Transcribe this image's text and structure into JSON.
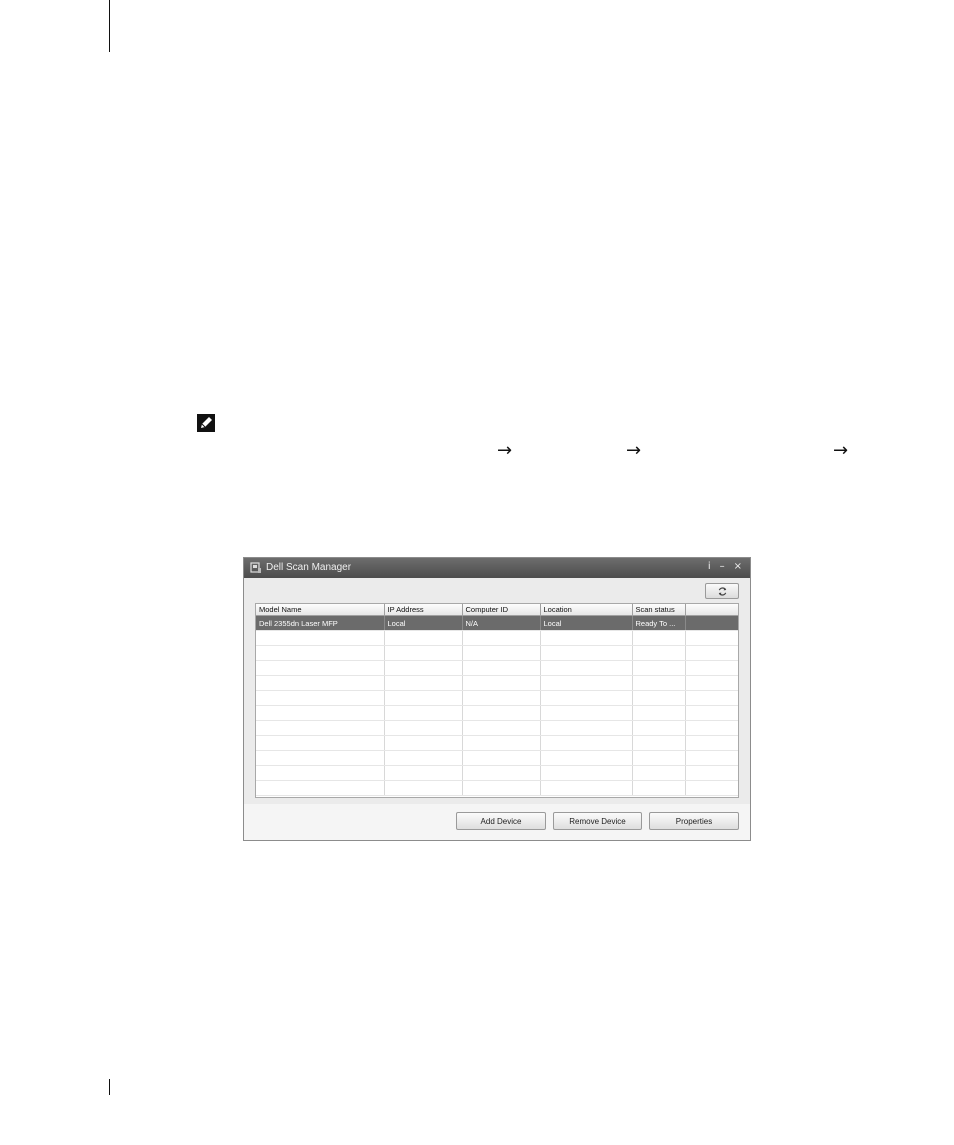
{
  "window": {
    "title": "Dell Scan Manager",
    "controls": {
      "info": "i",
      "minimize": "–",
      "close": "×"
    },
    "refresh_icon": "refresh-icon"
  },
  "table": {
    "columns": [
      "Model Name",
      "IP Address",
      "Computer ID",
      "Location",
      "Scan status",
      ""
    ],
    "rows": [
      [
        "Dell 2355dn Laser MFP",
        "Local",
        "N/A",
        "Local",
        "Ready To ...",
        ""
      ]
    ],
    "selected_row_color": "#6b6b6b"
  },
  "buttons": {
    "add": "Add Device",
    "remove": "Remove Device",
    "properties": "Properties"
  },
  "page": {
    "arrow": "→",
    "note_icon": "pencil-note-icon"
  }
}
